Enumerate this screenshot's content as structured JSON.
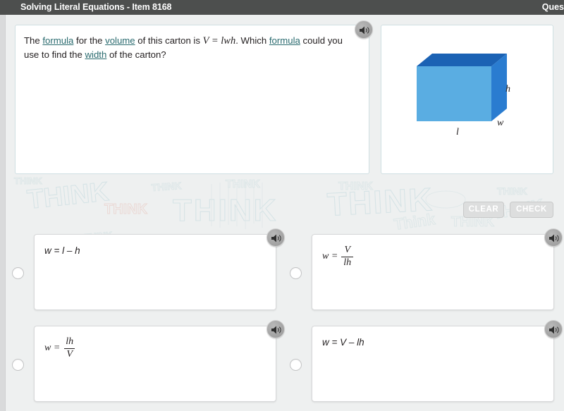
{
  "titlebar": {
    "left_title": "Solving Literal Equations - Item 8168",
    "right_title": "Ques"
  },
  "question": {
    "speaker_icon": "speaker-icon",
    "parts": [
      {
        "t": "The ",
        "style": "plain"
      },
      {
        "t": "formula",
        "style": "link"
      },
      {
        "t": " for the ",
        "style": "plain"
      },
      {
        "t": "volume",
        "style": "link"
      },
      {
        "t": " of this carton is ",
        "style": "plain"
      },
      {
        "t": "V = lwh",
        "style": "math"
      },
      {
        "t": ". Which ",
        "style": "plain"
      },
      {
        "t": "formula",
        "style": "link"
      },
      {
        "t": " could you use to find the ",
        "style": "plain"
      },
      {
        "t": "width",
        "style": "link"
      },
      {
        "t": " of the carton?",
        "style": "plain"
      }
    ],
    "full_text": "The formula for the volume of this carton is V = lwh. Which formula could you use to find the width of the carton?",
    "link_color": "#2a6b6f"
  },
  "figure": {
    "name": "carton-3d-box",
    "labels": {
      "height": "h",
      "width": "w",
      "length": "l"
    },
    "colors": {
      "front": "#5aade2",
      "top": "#1b62b4",
      "side": "#2a7cd0"
    }
  },
  "actions": {
    "clear_label": "CLEAR",
    "check_label": "CHECK",
    "disabled": true
  },
  "options": [
    {
      "id": "a",
      "kind": "plain",
      "text": "w = l – h",
      "selected": false,
      "speaker_icon": "speaker-icon"
    },
    {
      "id": "b",
      "kind": "fraction",
      "lhs": "w =",
      "numerator": "V",
      "denominator": "lh",
      "text": "w = V/lh",
      "selected": false,
      "speaker_icon": "speaker-icon"
    },
    {
      "id": "c",
      "kind": "fraction",
      "lhs": "w =",
      "numerator": "lh",
      "denominator": "V",
      "text": "w = lh/V",
      "selected": false,
      "speaker_icon": "speaker-icon"
    },
    {
      "id": "d",
      "kind": "plain",
      "text": "w = V – lh",
      "selected": false,
      "speaker_icon": "speaker-icon"
    }
  ],
  "background": {
    "watermark_words": [
      "THINK",
      "THINK",
      "THINK",
      "THINK",
      "Think",
      "THINK",
      "THINK",
      "THINK",
      "THINK"
    ],
    "watermark_color": "#bfd8dd"
  }
}
